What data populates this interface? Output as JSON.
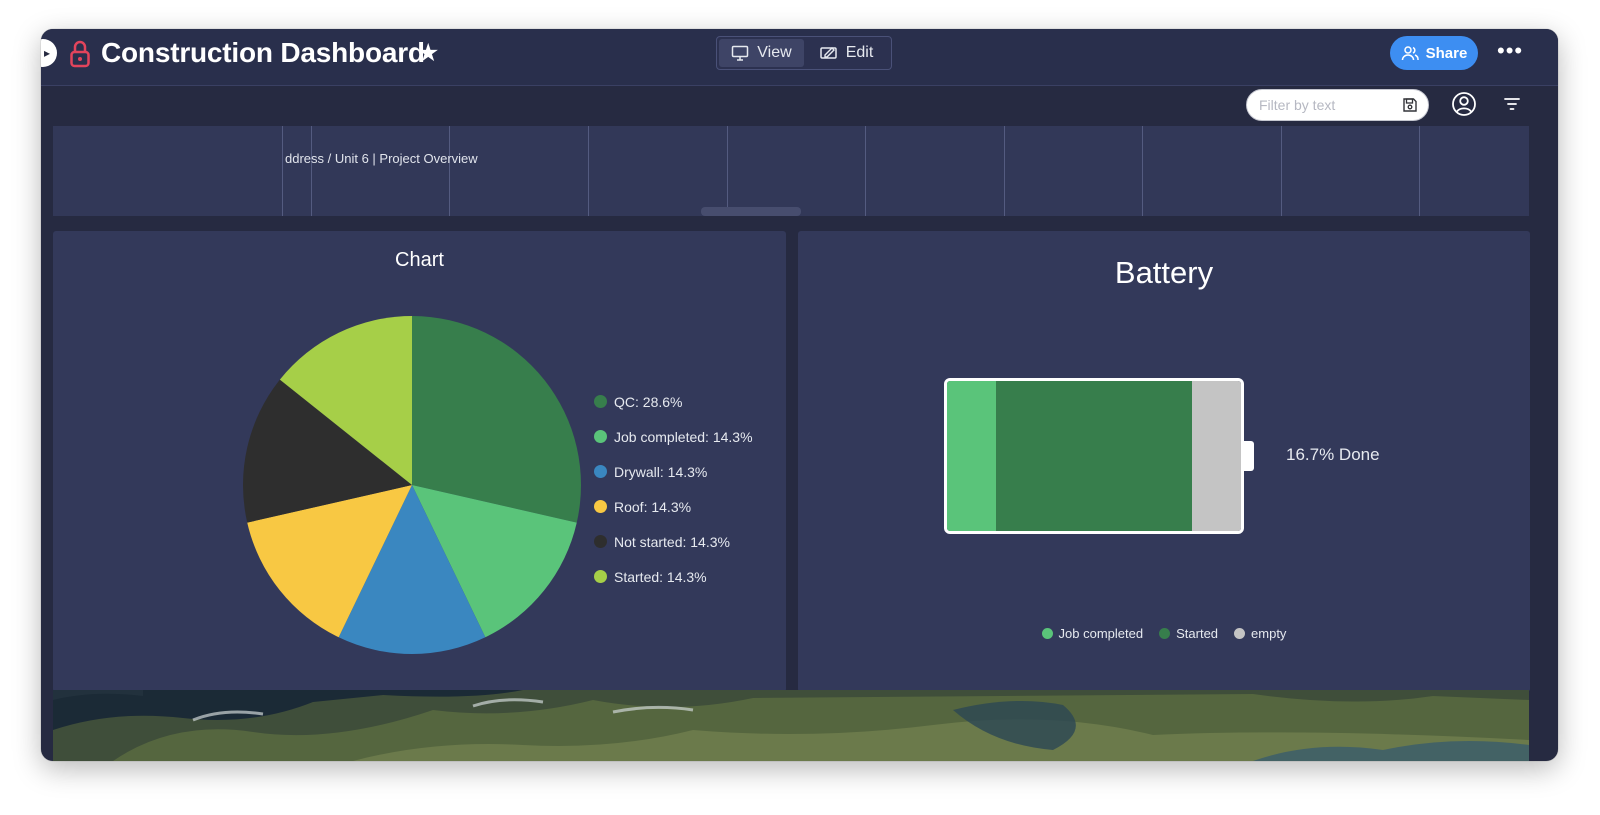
{
  "header": {
    "title": "Construction Dashboard",
    "view_label": "View",
    "edit_label": "Edit",
    "share_label": "Share"
  },
  "toolbar": {
    "filter_placeholder": "Filter by text"
  },
  "embed": {
    "breadcrumb": "ddress / Unit 6 | Project Overview"
  },
  "chart_widget": {
    "title": "Chart"
  },
  "chart_data": {
    "type": "pie",
    "title": "Chart",
    "slices": [
      {
        "name": "QC",
        "value": 28.6,
        "label": "QC: 28.6%",
        "color": "#377e4c"
      },
      {
        "name": "Job completed",
        "value": 14.3,
        "label": "Job completed: 14.3%",
        "color": "#5ac47a"
      },
      {
        "name": "Drywall",
        "value": 14.3,
        "label": "Drywall: 14.3%",
        "color": "#3a87c0"
      },
      {
        "name": "Roof",
        "value": 14.3,
        "label": "Roof: 14.3%",
        "color": "#f8c843"
      },
      {
        "name": "Not started",
        "value": 14.3,
        "label": "Not started: 14.3%",
        "color": "#2e2e2e"
      },
      {
        "name": "Started",
        "value": 14.3,
        "label": "Started: 14.3%",
        "color": "#a6cf48"
      }
    ],
    "legend_position": "right"
  },
  "battery_widget": {
    "title": "Battery",
    "done_label": "16.7% Done",
    "segments": [
      {
        "name": "Job completed",
        "fraction": 0.167,
        "color": "#5ac47a"
      },
      {
        "name": "Started",
        "fraction": 0.667,
        "color": "#377e4c"
      },
      {
        "name": "empty",
        "fraction": 0.166,
        "color": "#c4c4c4"
      }
    ],
    "legend": [
      "Job completed",
      "Started",
      "empty"
    ]
  },
  "colors": {
    "accent": "#3d8ef2",
    "lock": "#e2445c",
    "background": "#262a41",
    "widget": "#33395a"
  }
}
